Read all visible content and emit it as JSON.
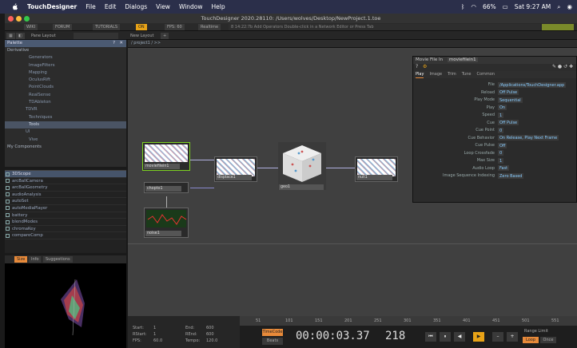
{
  "menubar": {
    "app": "TouchDesigner",
    "items": [
      "File",
      "Edit",
      "Dialogs",
      "View",
      "Window",
      "Help"
    ],
    "battery": "66%",
    "clock": "Sat 9:27 AM"
  },
  "titlebar": {
    "title": "TouchDesigner 2020.28110: /Users/wolves/Desktop/NewProject.1.toe"
  },
  "toolbar1": {
    "wiki": "WIKI",
    "forum": "FORUM",
    "tutorials": "TUTORIALS",
    "fps": "FPS: 60",
    "realtime": "Realtime",
    "hint": "8 14:22:7b Add Operators Double-click in a Network Editor or Press Tab"
  },
  "toolbar2": {
    "pane_layout": "Pane Layout",
    "new_layout": "New Layout",
    "path": "/ project1 / >>"
  },
  "palette": {
    "title": "Palette",
    "items": [
      {
        "label": "Derivative",
        "type": "hdr"
      },
      {
        "label": "Generators",
        "type": "item"
      },
      {
        "label": "ImageFilters",
        "type": "item"
      },
      {
        "label": "Mapping",
        "type": "item"
      },
      {
        "label": "OculusRift",
        "type": "item"
      },
      {
        "label": "PointClouds",
        "type": "item"
      },
      {
        "label": "RealSense",
        "type": "item"
      },
      {
        "label": "TDAbleton",
        "type": "item"
      },
      {
        "label": "TDVR",
        "type": "sub"
      },
      {
        "label": "Techniques",
        "type": "item"
      },
      {
        "label": "Tools",
        "type": "sel"
      },
      {
        "label": "UI",
        "type": "sub"
      },
      {
        "label": "Vive",
        "type": "item"
      },
      {
        "label": "My Components",
        "type": "hdr"
      }
    ],
    "tox": [
      "3DScope",
      "arcBallCamera",
      "arcBallGeometry",
      "audioAnalysis",
      "autoSet",
      "autoMediaPlayer",
      "battery",
      "blendModes",
      "chromaKey",
      "compareComp"
    ]
  },
  "preview_tabs": [
    "Size",
    "Info",
    "Suggestions"
  ],
  "nodes": {
    "moviefilein": "moviefilein1",
    "displace": "displace1",
    "chopto": "chopto1",
    "noise": "noise1",
    "geo": "geo1",
    "null": "null1"
  },
  "param": {
    "title": "Movie File In",
    "name": "moviefilein1",
    "tabs": [
      "Play",
      "Image",
      "Trim",
      "Tune",
      "Common"
    ],
    "rows": [
      {
        "label": "File",
        "value": "/Applications/TouchDesigner.app"
      },
      {
        "label": "Reload",
        "value": "Off  Pulse"
      },
      {
        "label": "Play Mode",
        "value": "Sequential"
      },
      {
        "label": "Play",
        "value": "On"
      },
      {
        "label": "Speed",
        "value": "1"
      },
      {
        "label": "Cue",
        "value": "Off  Pulse"
      },
      {
        "label": "Cue Point",
        "value": "0"
      },
      {
        "label": "Cue Behavior",
        "value": "On Release, Play Next Frame"
      },
      {
        "label": "Cue Pulse",
        "value": "Off"
      },
      {
        "label": "Loop Crossfade",
        "value": "0"
      },
      {
        "label": "Max Size",
        "value": "1"
      },
      {
        "label": "Audio Loop",
        "value": "Fast"
      },
      {
        "label": "Image Sequence Indexing",
        "value": "Zero Based"
      }
    ]
  },
  "timeline": {
    "ticks": [
      "51",
      "101",
      "151",
      "201",
      "251",
      "301",
      "351",
      "401",
      "451",
      "501",
      "551"
    ],
    "timecode": "00:00:03.37",
    "frame": "218",
    "timecode_label": "TimeCode",
    "beats_label": "Beats",
    "range_label": "Range Limit",
    "loop": "Loop",
    "once": "Once",
    "info": [
      {
        "k": "Start:",
        "v": "1",
        "k2": "End:",
        "v2": "600"
      },
      {
        "k": "RStart:",
        "v": "1",
        "k2": "REnd:",
        "v2": "600"
      },
      {
        "k": "FPS:",
        "v": "60.0",
        "k2": "Tempo:",
        "v2": "120.0"
      }
    ]
  },
  "colors": {
    "menubar": "#2b2f4a",
    "accent": "#f0a020",
    "selected_node": "#7ed321",
    "wire": "#b0b0e0"
  }
}
